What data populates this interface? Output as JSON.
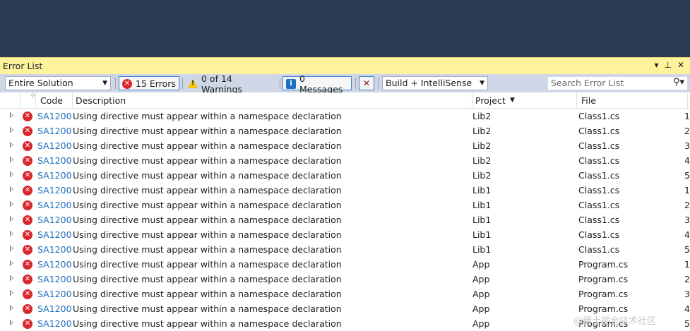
{
  "panel": {
    "title": "Error List",
    "icons": [
      "dropdown-icon",
      "pin-icon",
      "close-icon"
    ]
  },
  "toolbar": {
    "scope": "Entire Solution",
    "errors": "15 Errors",
    "warnings": "0 of 14 Warnings",
    "messages": "0 Messages",
    "build_filter": "Build + IntelliSense",
    "search_placeholder": "Search Error List"
  },
  "columns": {
    "code": "Code",
    "description": "Description",
    "project": "Project",
    "file": "File"
  },
  "rows": [
    {
      "code": "SA1200",
      "description": "Using directive must appear within a namespace declaration",
      "project": "Lib2",
      "file": "Class1.cs",
      "line": "1"
    },
    {
      "code": "SA1200",
      "description": "Using directive must appear within a namespace declaration",
      "project": "Lib2",
      "file": "Class1.cs",
      "line": "2"
    },
    {
      "code": "SA1200",
      "description": "Using directive must appear within a namespace declaration",
      "project": "Lib2",
      "file": "Class1.cs",
      "line": "3"
    },
    {
      "code": "SA1200",
      "description": "Using directive must appear within a namespace declaration",
      "project": "Lib2",
      "file": "Class1.cs",
      "line": "4"
    },
    {
      "code": "SA1200",
      "description": "Using directive must appear within a namespace declaration",
      "project": "Lib2",
      "file": "Class1.cs",
      "line": "5"
    },
    {
      "code": "SA1200",
      "description": "Using directive must appear within a namespace declaration",
      "project": "Lib1",
      "file": "Class1.cs",
      "line": "1"
    },
    {
      "code": "SA1200",
      "description": "Using directive must appear within a namespace declaration",
      "project": "Lib1",
      "file": "Class1.cs",
      "line": "2"
    },
    {
      "code": "SA1200",
      "description": "Using directive must appear within a namespace declaration",
      "project": "Lib1",
      "file": "Class1.cs",
      "line": "3"
    },
    {
      "code": "SA1200",
      "description": "Using directive must appear within a namespace declaration",
      "project": "Lib1",
      "file": "Class1.cs",
      "line": "4"
    },
    {
      "code": "SA1200",
      "description": "Using directive must appear within a namespace declaration",
      "project": "Lib1",
      "file": "Class1.cs",
      "line": "5"
    },
    {
      "code": "SA1200",
      "description": "Using directive must appear within a namespace declaration",
      "project": "App",
      "file": "Program.cs",
      "line": "1"
    },
    {
      "code": "SA1200",
      "description": "Using directive must appear within a namespace declaration",
      "project": "App",
      "file": "Program.cs",
      "line": "2"
    },
    {
      "code": "SA1200",
      "description": "Using directive must appear within a namespace declaration",
      "project": "App",
      "file": "Program.cs",
      "line": "3"
    },
    {
      "code": "SA1200",
      "description": "Using directive must appear within a namespace declaration",
      "project": "App",
      "file": "Program.cs",
      "line": "4"
    },
    {
      "code": "SA1200",
      "description": "Using directive must appear within a namespace declaration",
      "project": "App",
      "file": "Program.cs",
      "line": "5"
    }
  ],
  "watermark": "@稀土掘金技术社区",
  "colors": {
    "title_bar": "#fff29d",
    "toolbar": "#cfd6e5",
    "top_band": "#2b3a55",
    "code_link": "#1e6fbb",
    "error_icon": "#d9272e"
  }
}
